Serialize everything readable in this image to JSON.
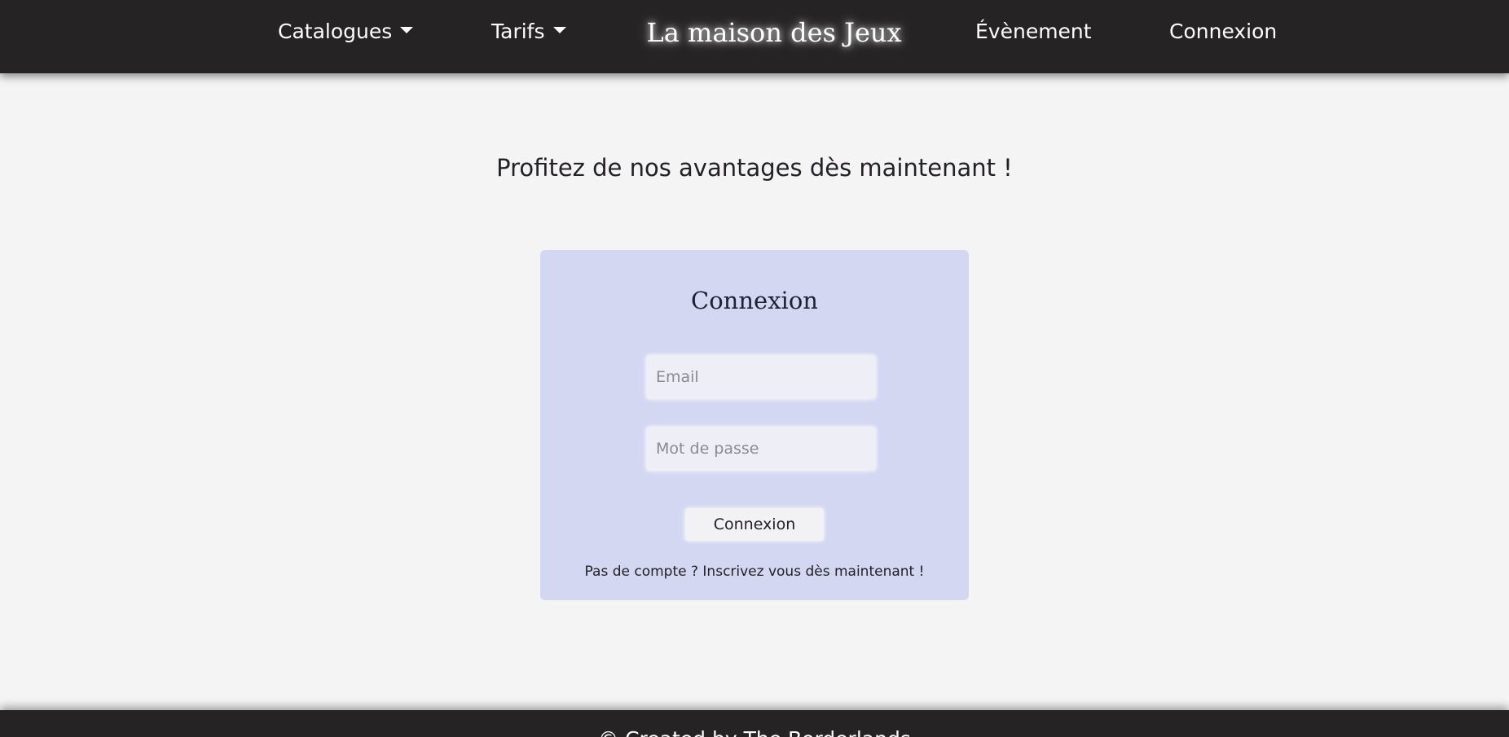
{
  "navbar": {
    "brand": "La maison des Jeux",
    "items": [
      {
        "label": "Catalogues",
        "dropdown": true
      },
      {
        "label": "Tarifs",
        "dropdown": true
      },
      {
        "label": "Évènement",
        "dropdown": false
      },
      {
        "label": "Connexion",
        "dropdown": false
      }
    ],
    "dropdown_icon": "caret-down-icon"
  },
  "hero": {
    "headline": "Profitez de nos avantages dès maintenant !"
  },
  "login_card": {
    "title": "Connexion",
    "email": {
      "value": "",
      "placeholder": "Email"
    },
    "password": {
      "value": "",
      "placeholder": "Mot de passe"
    },
    "submit_label": "Connexion",
    "signup_text": "Pas de compte ? Inscrivez vous dès maintenant !"
  },
  "footer": {
    "text": "© Created by The Borderlands"
  },
  "colors": {
    "navbar_bg": "#252324",
    "page_bg": "#f4f4f4",
    "card_bg": "#d4d7f2",
    "text": "#232126"
  }
}
